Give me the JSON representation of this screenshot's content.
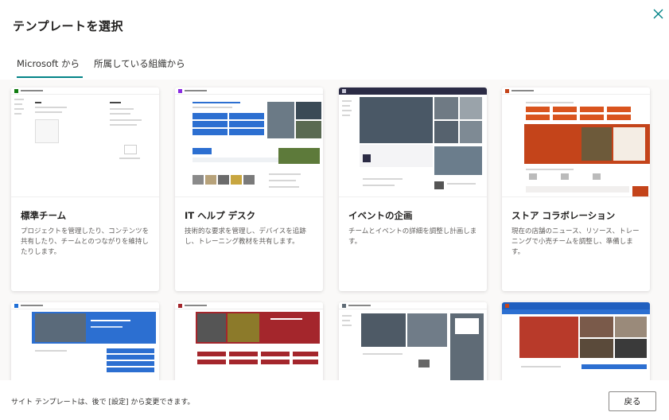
{
  "dialog": {
    "title": "テンプレートを選択",
    "close_icon": "close-icon"
  },
  "tabs": [
    {
      "label": "Microsoft から",
      "active": true
    },
    {
      "label": "所属している組織から",
      "active": false
    }
  ],
  "templates": [
    {
      "title": "標準チーム",
      "description": "プロジェクトを管理したり、コンテンツを共有したり、チームとのつながりを維持したりします。",
      "accent": "#107c10"
    },
    {
      "title": "IT ヘルプ デスク",
      "description": "技術的な要求を管理し、デバイスを追跡し、トレーニング教材を共有します。",
      "accent": "#8a2be2"
    },
    {
      "title": "イベントの企画",
      "description": "チームとイベントの詳細を調整し計画します。",
      "accent": "#2b2b45"
    },
    {
      "title": "ストア コラボレーション",
      "description": "現在の店舗のニュース、リソース、トレーニングで小売チームを調整し、準備します。",
      "accent": "#c4441a"
    },
    {
      "title": "",
      "description": "",
      "accent": "#1f6fd6"
    },
    {
      "title": "",
      "description": "",
      "accent": "#a4262c"
    },
    {
      "title": "",
      "description": "",
      "accent": "#5f6b76"
    },
    {
      "title": "",
      "description": "",
      "accent": "#1f5fbf"
    }
  ],
  "footer": {
    "note": "サイト テンプレートは、後で [設定] から変更できます。",
    "back_label": "戻る"
  }
}
